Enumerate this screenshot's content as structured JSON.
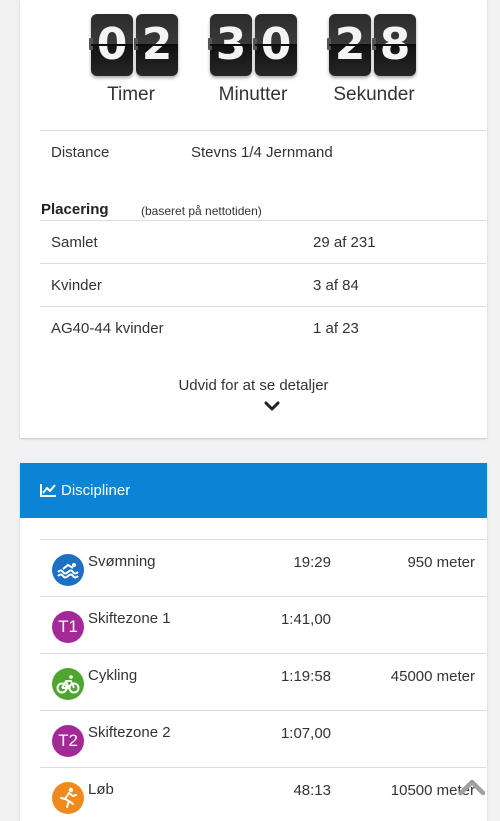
{
  "countdown": {
    "hours": [
      "0",
      "2"
    ],
    "minutes": [
      "3",
      "0"
    ],
    "seconds": [
      "2",
      "8"
    ],
    "labels": {
      "hours": "Timer",
      "minutes": "Minutter",
      "seconds": "Sekunder"
    }
  },
  "distance": {
    "label": "Distance",
    "value": "Stevns 1/4 Jernmand"
  },
  "placering": {
    "title": "Placering",
    "note": "(baseret på nettotiden)",
    "rows": [
      {
        "label": "Samlet",
        "value": "29 af 231"
      },
      {
        "label": "Kvinder",
        "value": "3 af 84"
      },
      {
        "label": "AG40-44 kvinder",
        "value": "1 af 23"
      }
    ]
  },
  "expand": {
    "label": "Udvid for at se detaljer"
  },
  "discipliner": {
    "title": "Discipliner",
    "rows": [
      {
        "name": "Svømning",
        "time": "19:29",
        "distance": "950 meter",
        "icon": "swim-icon",
        "icon_text": "",
        "color": "#1f6fc4"
      },
      {
        "name": "Skiftezone 1",
        "time": "1:41,00",
        "distance": "",
        "icon": "t1-icon",
        "icon_text": "T1",
        "color": "#a32a96"
      },
      {
        "name": "Cykling",
        "time": "1:19:58",
        "distance": "45000 meter",
        "icon": "bike-icon",
        "icon_text": "",
        "color": "#4fa532"
      },
      {
        "name": "Skiftezone 2",
        "time": "1:07,00",
        "distance": "",
        "icon": "t2-icon",
        "icon_text": "T2",
        "color": "#a32a96"
      },
      {
        "name": "Løb",
        "time": "48:13",
        "distance": "10500 meter",
        "icon": "run-icon",
        "icon_text": "",
        "color": "#f08a1c"
      }
    ]
  },
  "colors": {
    "accent": "#0a84d4",
    "background": "#f1f1f1"
  }
}
